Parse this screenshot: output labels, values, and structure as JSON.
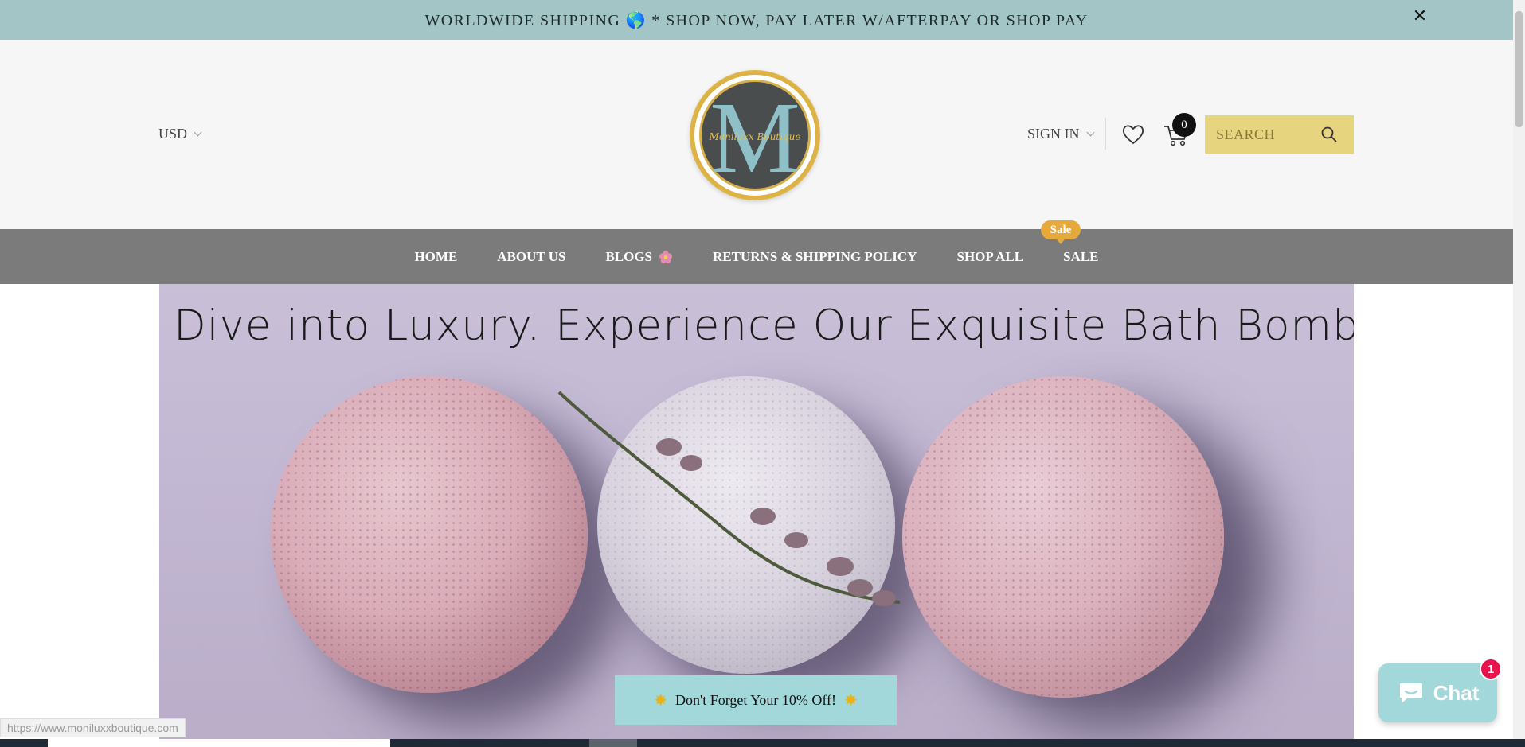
{
  "announcement": {
    "text": "WORLDWIDE SHIPPING 🌎 * SHOP NOW, PAY LATER W/AFTERPAY OR SHOP PAY",
    "close_label": "✕"
  },
  "header": {
    "currency": "USD",
    "logo_script": "Moniluxx Boutique",
    "logo_letter": "M",
    "sign_in": "SIGN IN",
    "cart_count": "0",
    "search_placeholder": "SEARCH"
  },
  "nav": {
    "items": [
      {
        "label": "HOME"
      },
      {
        "label": "ABOUT US"
      },
      {
        "label": "BLOGS"
      },
      {
        "label": "RETURNS & SHIPPING POLICY"
      },
      {
        "label": "SHOP ALL"
      },
      {
        "label": "SALE"
      }
    ],
    "sale_badge": "Sale"
  },
  "hero": {
    "title": "Dive into Luxury. Experience Our Exquisite Bath Bombs.",
    "promo": "Don't Forget Your 10% Off!"
  },
  "chat": {
    "label": "Chat",
    "badge": "1"
  },
  "status_url": "https://www.moniluxxboutique.com",
  "colors": {
    "announcement_bg": "#a3c5c6",
    "header_bg": "#f6f6f6",
    "nav_bg": "#7b7b7b",
    "search_bg": "#e7d47e",
    "sale_badge": "#e6a93b",
    "promo_bg": "#a3d8da",
    "chat_badge": "#e8124c"
  }
}
